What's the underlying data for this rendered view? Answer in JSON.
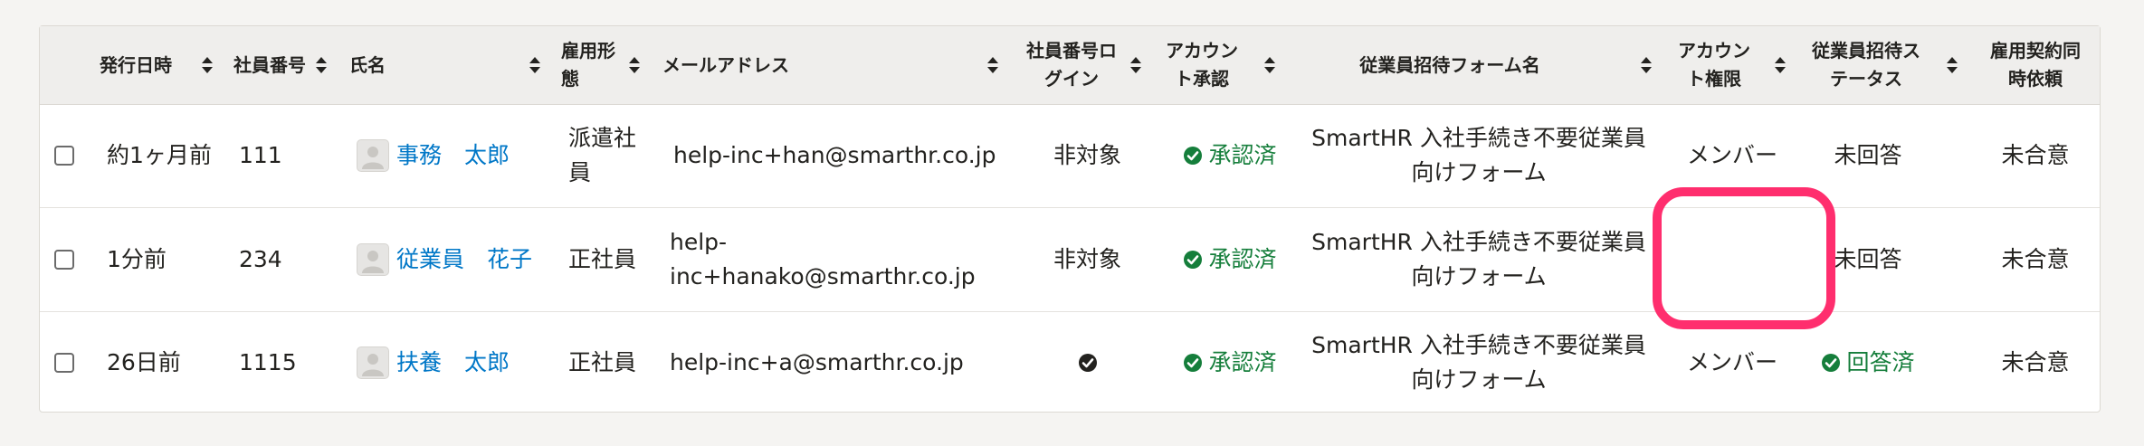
{
  "headers": {
    "issued": "発行日時",
    "emp_no": "社員番号",
    "name": "氏名",
    "emp_type_1": "雇用形",
    "emp_type_2": "態",
    "email": "メールアドレス",
    "login_1": "社員番号ロ",
    "login_2": "グイン",
    "approval_1": "アカウン",
    "approval_2": "ト承認",
    "form": "従業員招待フォーム名",
    "perm_1": "アカウン",
    "perm_2": "ト権限",
    "invite_1": "従業員招待ス",
    "invite_2": "テータス",
    "contract_1": "雇用契約同",
    "contract_2": "時依頼"
  },
  "rows": [
    {
      "issued": "約1ヶ月前",
      "emp_no": "111",
      "name": "事務　太郎",
      "emp_type_1": "派遣社",
      "emp_type_2": "員",
      "email_1": "help-inc+han@smarthr.co.jp",
      "email_2": "",
      "login": "非対象",
      "approval": "承認済",
      "form_1": "SmartHR 入社手続き不要従業員",
      "form_2": "向けフォーム",
      "perm": "メンバー",
      "invite": "未回答",
      "contract": "未合意"
    },
    {
      "issued": "1分前",
      "emp_no": "234",
      "name": "従業員　花子",
      "emp_type_1": "正社員",
      "emp_type_2": "",
      "email_1": "help-",
      "email_2": "inc+hanako@smarthr.co.jp",
      "login": "非対象",
      "approval": "承認済",
      "form_1": "SmartHR 入社手続き不要従業員",
      "form_2": "向けフォーム",
      "perm": "",
      "invite": "未回答",
      "contract": "未合意"
    },
    {
      "issued": "26日前",
      "emp_no": "1115",
      "name": "扶養　太郎",
      "emp_type_1": "正社員",
      "emp_type_2": "",
      "email_1": "help-inc+a@smarthr.co.jp",
      "email_2": "",
      "login": "",
      "approval": "承認済",
      "form_1": "SmartHR 入社手続き不要従業員",
      "form_2": "向けフォーム",
      "perm": "メンバー",
      "invite": "回答済",
      "contract": "未合意"
    }
  ],
  "icons": {
    "sort": "sort-icon",
    "check": "check-circle-icon",
    "avatar": "user-avatar-icon"
  },
  "colors": {
    "link": "#0077c7",
    "success": "#157e3b",
    "highlight": "#ff2e6e",
    "header_bg": "#efeeec"
  }
}
